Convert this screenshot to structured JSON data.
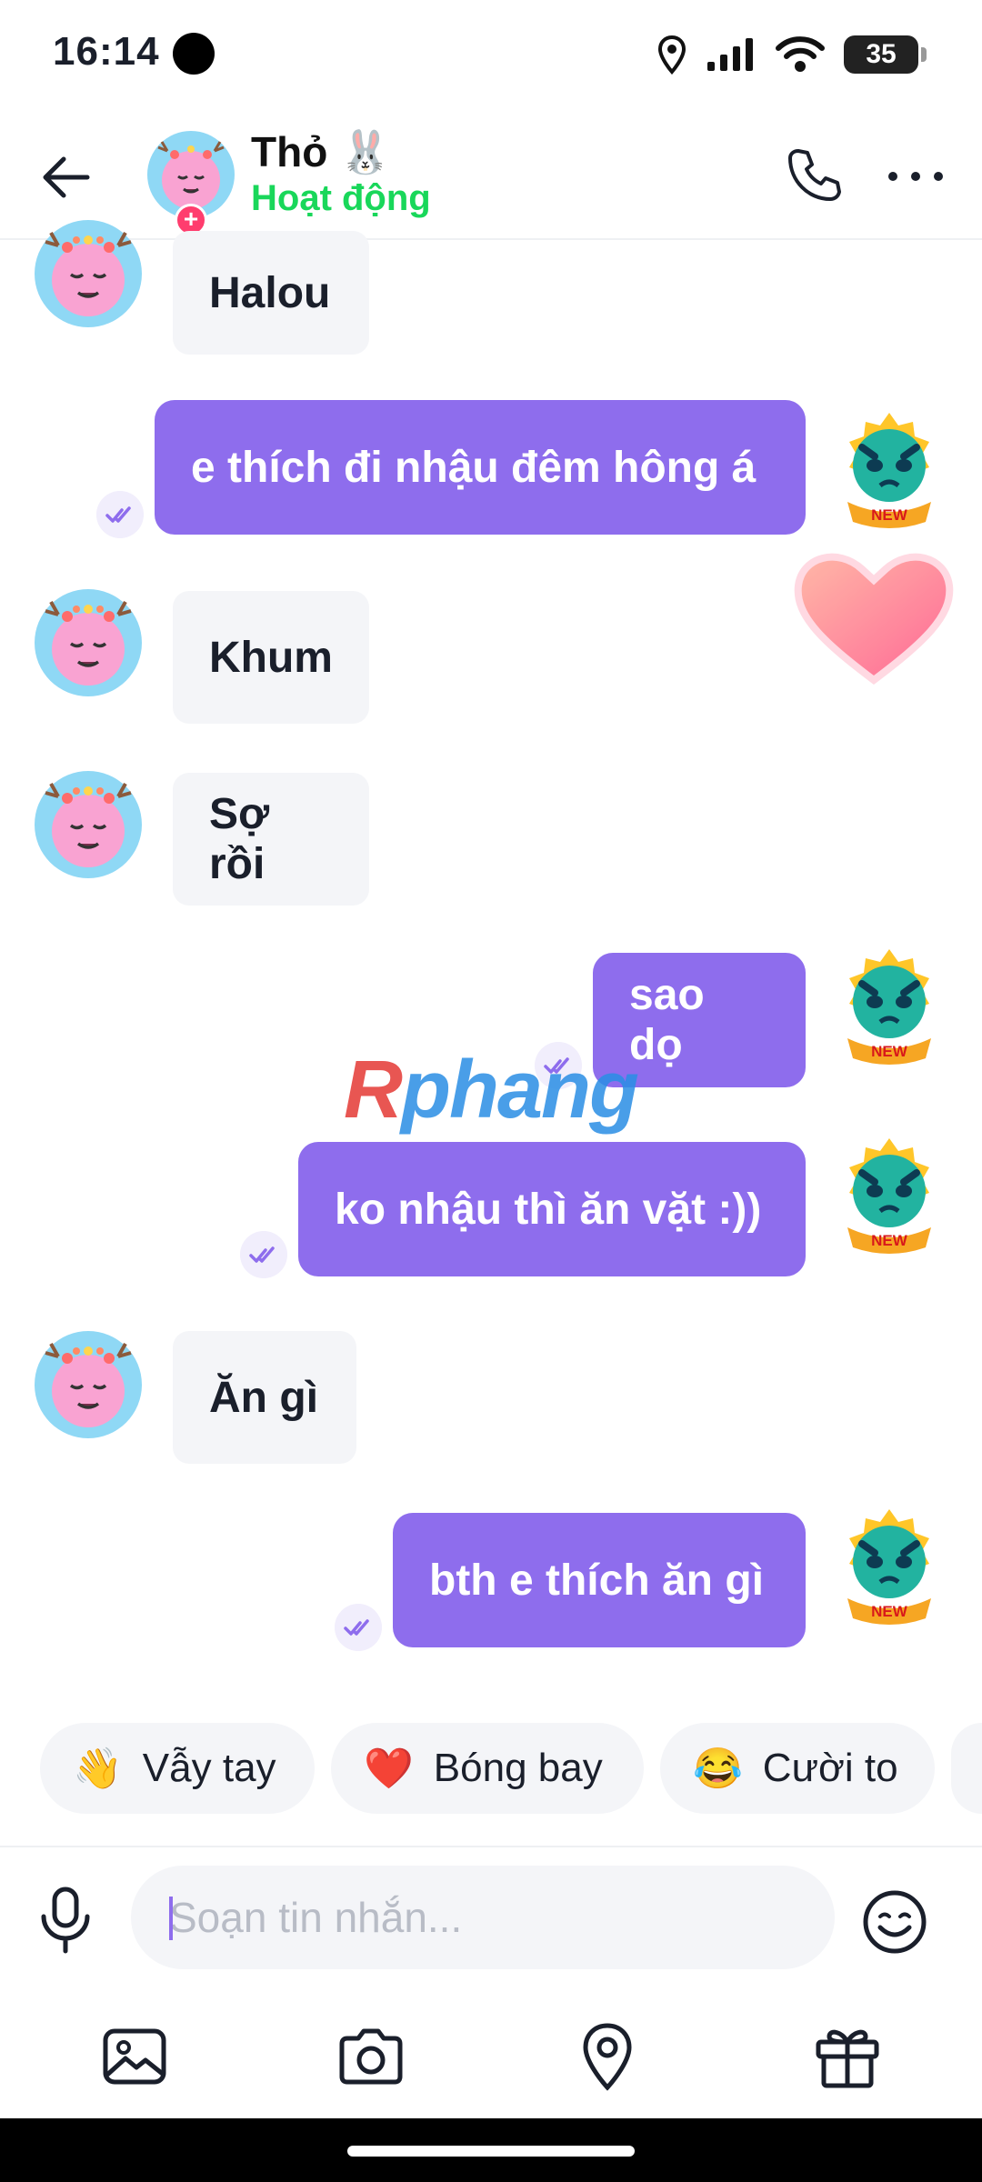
{
  "status_bar": {
    "time": "16:14",
    "battery": "35"
  },
  "header": {
    "name": "Thỏ 🐰",
    "status": "Hoạt động"
  },
  "messages": [
    {
      "side": "in",
      "text": "Halou"
    },
    {
      "side": "out",
      "text": "e thích đi nhậu đêm hông á"
    },
    {
      "side": "in",
      "text": "Khum"
    },
    {
      "side": "in",
      "text": "Sợ rồi"
    },
    {
      "side": "out",
      "text": "sao dọ"
    },
    {
      "side": "out",
      "text": "ko nhậu thì ăn vặt :))"
    },
    {
      "side": "in",
      "text": "Ăn gì"
    },
    {
      "side": "out",
      "text": "bth e thích ăn gì"
    }
  ],
  "avatar_badge": "NEW",
  "watermark": {
    "first": "R",
    "rest": "phang"
  },
  "quick_replies": [
    {
      "emoji": "👋",
      "label": "Vẫy tay"
    },
    {
      "emoji": "❤️",
      "label": "Bóng bay"
    },
    {
      "emoji": "😂",
      "label": "Cười to"
    }
  ],
  "composer": {
    "placeholder": "Soạn tin nhắn..."
  },
  "colors": {
    "accent": "#8e6ded",
    "online": "#19d75a",
    "incoming_bg": "#f4f5f8"
  },
  "icons": [
    "back-arrow-icon",
    "phone-icon",
    "more-icon",
    "mic-icon",
    "emoji-icon",
    "image-icon",
    "camera-icon",
    "location-icon",
    "gift-icon",
    "double-check-icon"
  ]
}
